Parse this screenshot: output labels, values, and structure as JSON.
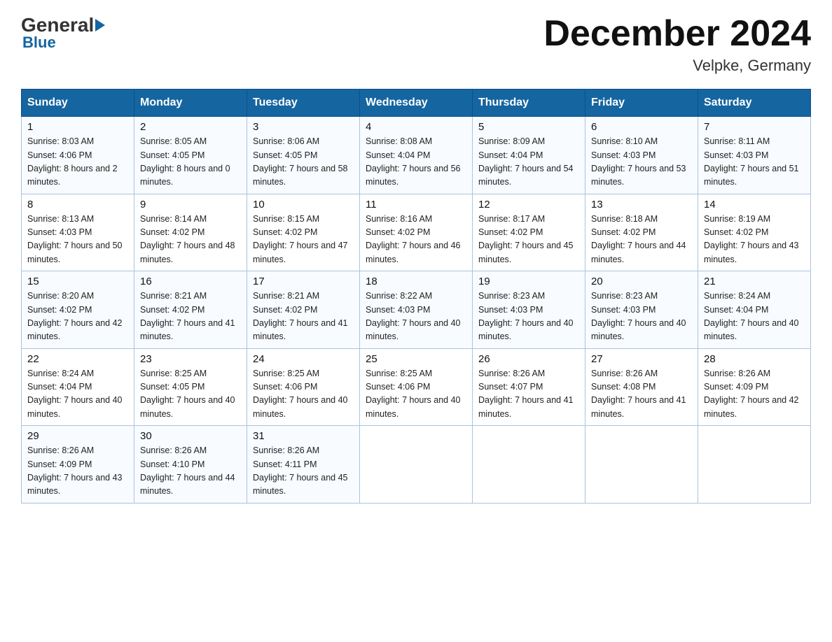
{
  "logo": {
    "general": "General",
    "blue": "Blue"
  },
  "header": {
    "month_year": "December 2024",
    "location": "Velpke, Germany"
  },
  "days_of_week": [
    "Sunday",
    "Monday",
    "Tuesday",
    "Wednesday",
    "Thursday",
    "Friday",
    "Saturday"
  ],
  "weeks": [
    [
      {
        "day": "1",
        "sunrise": "8:03 AM",
        "sunset": "4:06 PM",
        "daylight": "8 hours and 2 minutes."
      },
      {
        "day": "2",
        "sunrise": "8:05 AM",
        "sunset": "4:05 PM",
        "daylight": "8 hours and 0 minutes."
      },
      {
        "day": "3",
        "sunrise": "8:06 AM",
        "sunset": "4:05 PM",
        "daylight": "7 hours and 58 minutes."
      },
      {
        "day": "4",
        "sunrise": "8:08 AM",
        "sunset": "4:04 PM",
        "daylight": "7 hours and 56 minutes."
      },
      {
        "day": "5",
        "sunrise": "8:09 AM",
        "sunset": "4:04 PM",
        "daylight": "7 hours and 54 minutes."
      },
      {
        "day": "6",
        "sunrise": "8:10 AM",
        "sunset": "4:03 PM",
        "daylight": "7 hours and 53 minutes."
      },
      {
        "day": "7",
        "sunrise": "8:11 AM",
        "sunset": "4:03 PM",
        "daylight": "7 hours and 51 minutes."
      }
    ],
    [
      {
        "day": "8",
        "sunrise": "8:13 AM",
        "sunset": "4:03 PM",
        "daylight": "7 hours and 50 minutes."
      },
      {
        "day": "9",
        "sunrise": "8:14 AM",
        "sunset": "4:02 PM",
        "daylight": "7 hours and 48 minutes."
      },
      {
        "day": "10",
        "sunrise": "8:15 AM",
        "sunset": "4:02 PM",
        "daylight": "7 hours and 47 minutes."
      },
      {
        "day": "11",
        "sunrise": "8:16 AM",
        "sunset": "4:02 PM",
        "daylight": "7 hours and 46 minutes."
      },
      {
        "day": "12",
        "sunrise": "8:17 AM",
        "sunset": "4:02 PM",
        "daylight": "7 hours and 45 minutes."
      },
      {
        "day": "13",
        "sunrise": "8:18 AM",
        "sunset": "4:02 PM",
        "daylight": "7 hours and 44 minutes."
      },
      {
        "day": "14",
        "sunrise": "8:19 AM",
        "sunset": "4:02 PM",
        "daylight": "7 hours and 43 minutes."
      }
    ],
    [
      {
        "day": "15",
        "sunrise": "8:20 AM",
        "sunset": "4:02 PM",
        "daylight": "7 hours and 42 minutes."
      },
      {
        "day": "16",
        "sunrise": "8:21 AM",
        "sunset": "4:02 PM",
        "daylight": "7 hours and 41 minutes."
      },
      {
        "day": "17",
        "sunrise": "8:21 AM",
        "sunset": "4:02 PM",
        "daylight": "7 hours and 41 minutes."
      },
      {
        "day": "18",
        "sunrise": "8:22 AM",
        "sunset": "4:03 PM",
        "daylight": "7 hours and 40 minutes."
      },
      {
        "day": "19",
        "sunrise": "8:23 AM",
        "sunset": "4:03 PM",
        "daylight": "7 hours and 40 minutes."
      },
      {
        "day": "20",
        "sunrise": "8:23 AM",
        "sunset": "4:03 PM",
        "daylight": "7 hours and 40 minutes."
      },
      {
        "day": "21",
        "sunrise": "8:24 AM",
        "sunset": "4:04 PM",
        "daylight": "7 hours and 40 minutes."
      }
    ],
    [
      {
        "day": "22",
        "sunrise": "8:24 AM",
        "sunset": "4:04 PM",
        "daylight": "7 hours and 40 minutes."
      },
      {
        "day": "23",
        "sunrise": "8:25 AM",
        "sunset": "4:05 PM",
        "daylight": "7 hours and 40 minutes."
      },
      {
        "day": "24",
        "sunrise": "8:25 AM",
        "sunset": "4:06 PM",
        "daylight": "7 hours and 40 minutes."
      },
      {
        "day": "25",
        "sunrise": "8:25 AM",
        "sunset": "4:06 PM",
        "daylight": "7 hours and 40 minutes."
      },
      {
        "day": "26",
        "sunrise": "8:26 AM",
        "sunset": "4:07 PM",
        "daylight": "7 hours and 41 minutes."
      },
      {
        "day": "27",
        "sunrise": "8:26 AM",
        "sunset": "4:08 PM",
        "daylight": "7 hours and 41 minutes."
      },
      {
        "day": "28",
        "sunrise": "8:26 AM",
        "sunset": "4:09 PM",
        "daylight": "7 hours and 42 minutes."
      }
    ],
    [
      {
        "day": "29",
        "sunrise": "8:26 AM",
        "sunset": "4:09 PM",
        "daylight": "7 hours and 43 minutes."
      },
      {
        "day": "30",
        "sunrise": "8:26 AM",
        "sunset": "4:10 PM",
        "daylight": "7 hours and 44 minutes."
      },
      {
        "day": "31",
        "sunrise": "8:26 AM",
        "sunset": "4:11 PM",
        "daylight": "7 hours and 45 minutes."
      },
      null,
      null,
      null,
      null
    ]
  ]
}
